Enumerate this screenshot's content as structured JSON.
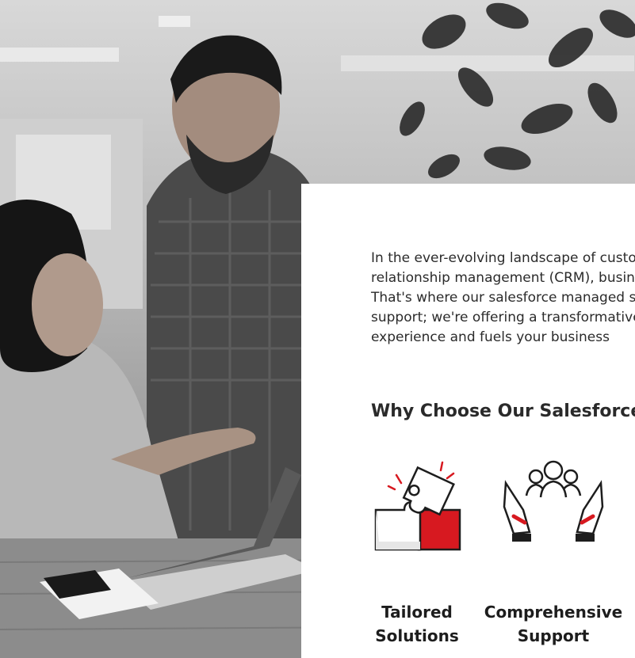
{
  "photo": {
    "description_icon": "office-photo-image"
  },
  "content": {
    "intro_lines": [
      "In the ever-evolving landscape of customer",
      "relationship management (CRM), businesses need",
      "That's where our salesforce managed services",
      "support; we're offering a transformative",
      "experience and fuels your business"
    ],
    "heading": "Why Choose Our Salesforce",
    "features": [
      {
        "icon": "puzzle-icon",
        "label_line1": "Tailored",
        "label_line2": "Solutions"
      },
      {
        "icon": "hands-support-icon",
        "label_line1": "Comprehensive",
        "label_line2": "Support"
      }
    ]
  },
  "colors": {
    "accent": "#d71920",
    "text": "#2b2b2b",
    "card": "#ffffff"
  }
}
